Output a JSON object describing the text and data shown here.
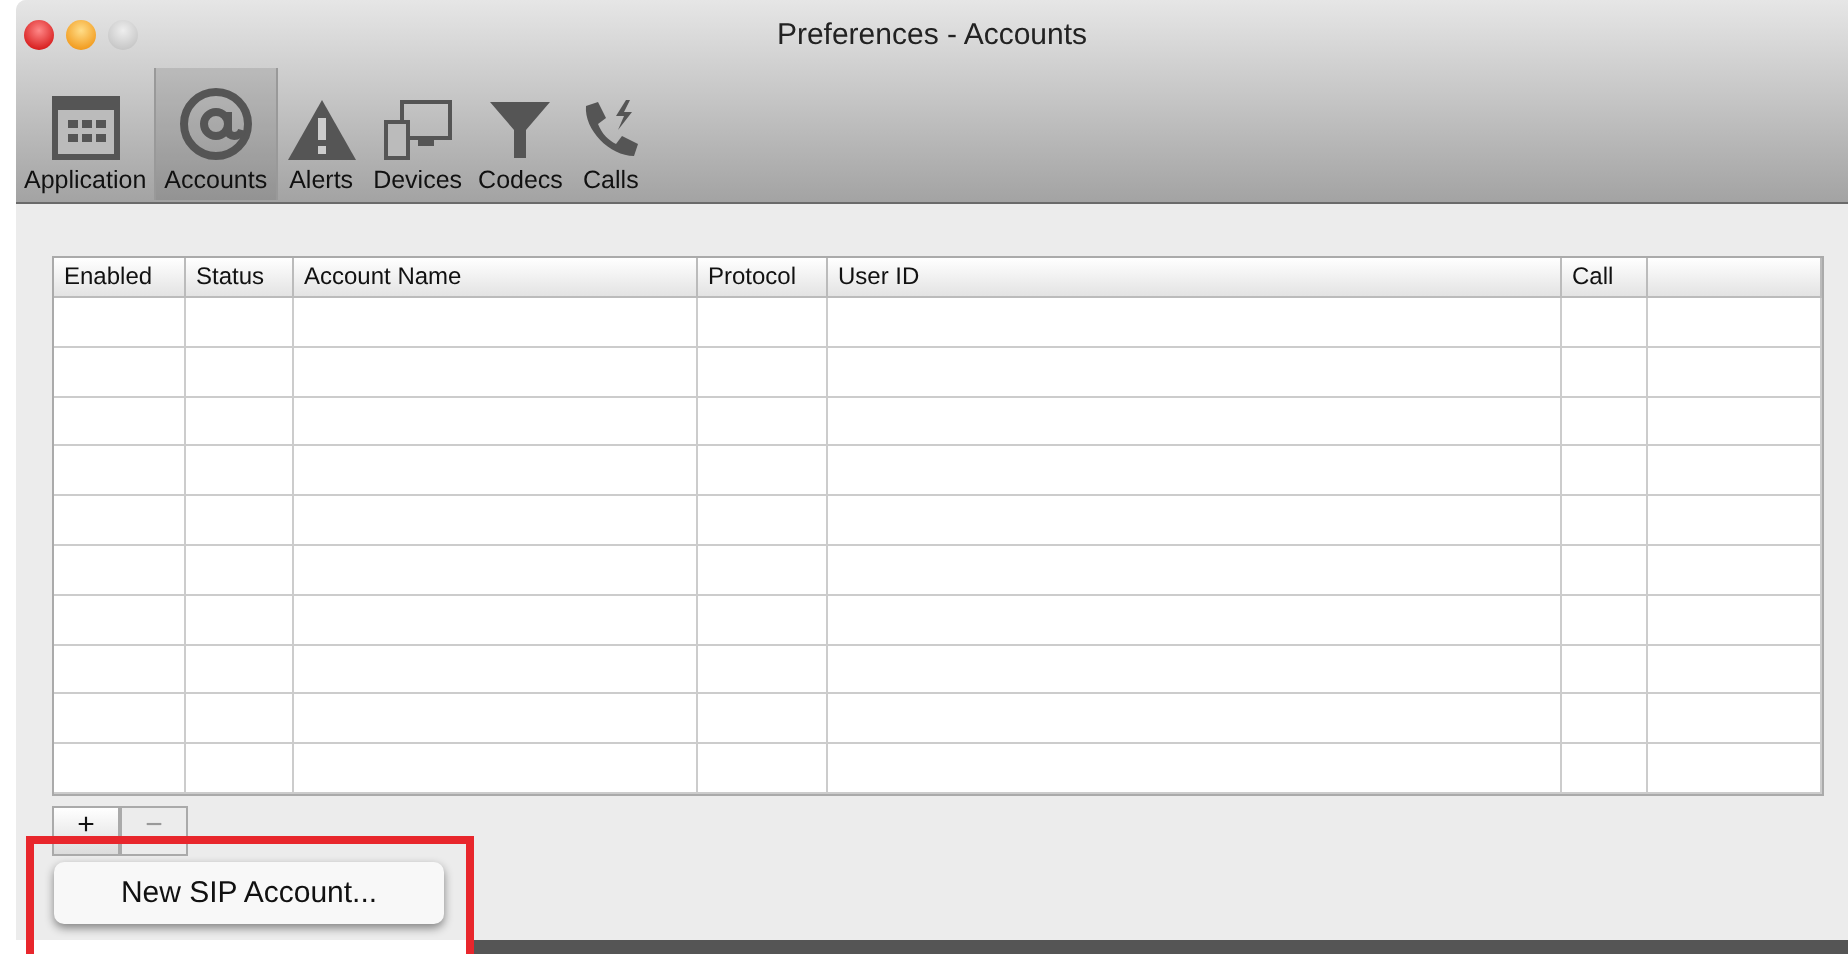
{
  "window": {
    "title": "Preferences - Accounts"
  },
  "toolbar": [
    {
      "label": "Application",
      "selected": false
    },
    {
      "label": "Accounts",
      "selected": true
    },
    {
      "label": "Alerts",
      "selected": false
    },
    {
      "label": "Devices",
      "selected": false
    },
    {
      "label": "Codecs",
      "selected": false
    },
    {
      "label": "Calls",
      "selected": false
    }
  ],
  "table": {
    "columns": [
      "Enabled",
      "Status",
      "Account Name",
      "Protocol",
      "User ID",
      "Call",
      ""
    ]
  },
  "buttons": [
    {
      "label": "+",
      "disabled": false
    },
    {
      "label": "−",
      "disabled": true
    }
  ],
  "menu": {
    "items": [
      "New SIP Account..."
    ],
    "highlighted": true
  }
}
